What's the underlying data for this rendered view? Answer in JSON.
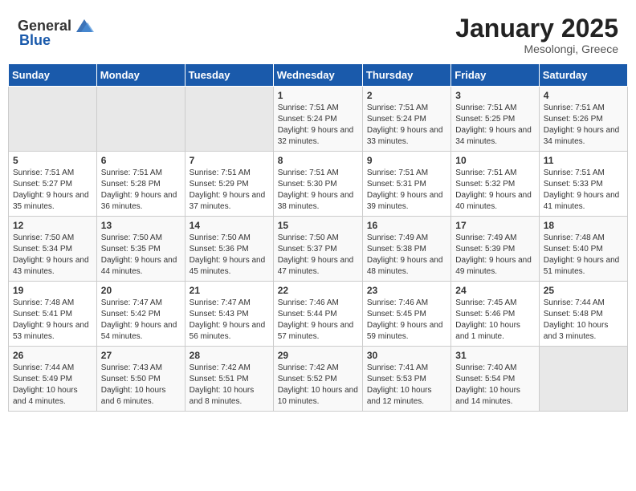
{
  "header": {
    "logo_general": "General",
    "logo_blue": "Blue",
    "month_title": "January 2025",
    "location": "Mesolongi, Greece"
  },
  "weekdays": [
    "Sunday",
    "Monday",
    "Tuesday",
    "Wednesday",
    "Thursday",
    "Friday",
    "Saturday"
  ],
  "weeks": [
    [
      {
        "day": "",
        "empty": true
      },
      {
        "day": "",
        "empty": true
      },
      {
        "day": "",
        "empty": true
      },
      {
        "day": "1",
        "sunrise": "7:51 AM",
        "sunset": "5:24 PM",
        "daylight": "9 hours and 32 minutes."
      },
      {
        "day": "2",
        "sunrise": "7:51 AM",
        "sunset": "5:24 PM",
        "daylight": "9 hours and 33 minutes."
      },
      {
        "day": "3",
        "sunrise": "7:51 AM",
        "sunset": "5:25 PM",
        "daylight": "9 hours and 34 minutes."
      },
      {
        "day": "4",
        "sunrise": "7:51 AM",
        "sunset": "5:26 PM",
        "daylight": "9 hours and 34 minutes."
      }
    ],
    [
      {
        "day": "5",
        "sunrise": "7:51 AM",
        "sunset": "5:27 PM",
        "daylight": "9 hours and 35 minutes."
      },
      {
        "day": "6",
        "sunrise": "7:51 AM",
        "sunset": "5:28 PM",
        "daylight": "9 hours and 36 minutes."
      },
      {
        "day": "7",
        "sunrise": "7:51 AM",
        "sunset": "5:29 PM",
        "daylight": "9 hours and 37 minutes."
      },
      {
        "day": "8",
        "sunrise": "7:51 AM",
        "sunset": "5:30 PM",
        "daylight": "9 hours and 38 minutes."
      },
      {
        "day": "9",
        "sunrise": "7:51 AM",
        "sunset": "5:31 PM",
        "daylight": "9 hours and 39 minutes."
      },
      {
        "day": "10",
        "sunrise": "7:51 AM",
        "sunset": "5:32 PM",
        "daylight": "9 hours and 40 minutes."
      },
      {
        "day": "11",
        "sunrise": "7:51 AM",
        "sunset": "5:33 PM",
        "daylight": "9 hours and 41 minutes."
      }
    ],
    [
      {
        "day": "12",
        "sunrise": "7:50 AM",
        "sunset": "5:34 PM",
        "daylight": "9 hours and 43 minutes."
      },
      {
        "day": "13",
        "sunrise": "7:50 AM",
        "sunset": "5:35 PM",
        "daylight": "9 hours and 44 minutes."
      },
      {
        "day": "14",
        "sunrise": "7:50 AM",
        "sunset": "5:36 PM",
        "daylight": "9 hours and 45 minutes."
      },
      {
        "day": "15",
        "sunrise": "7:50 AM",
        "sunset": "5:37 PM",
        "daylight": "9 hours and 47 minutes."
      },
      {
        "day": "16",
        "sunrise": "7:49 AM",
        "sunset": "5:38 PM",
        "daylight": "9 hours and 48 minutes."
      },
      {
        "day": "17",
        "sunrise": "7:49 AM",
        "sunset": "5:39 PM",
        "daylight": "9 hours and 49 minutes."
      },
      {
        "day": "18",
        "sunrise": "7:48 AM",
        "sunset": "5:40 PM",
        "daylight": "9 hours and 51 minutes."
      }
    ],
    [
      {
        "day": "19",
        "sunrise": "7:48 AM",
        "sunset": "5:41 PM",
        "daylight": "9 hours and 53 minutes."
      },
      {
        "day": "20",
        "sunrise": "7:47 AM",
        "sunset": "5:42 PM",
        "daylight": "9 hours and 54 minutes."
      },
      {
        "day": "21",
        "sunrise": "7:47 AM",
        "sunset": "5:43 PM",
        "daylight": "9 hours and 56 minutes."
      },
      {
        "day": "22",
        "sunrise": "7:46 AM",
        "sunset": "5:44 PM",
        "daylight": "9 hours and 57 minutes."
      },
      {
        "day": "23",
        "sunrise": "7:46 AM",
        "sunset": "5:45 PM",
        "daylight": "9 hours and 59 minutes."
      },
      {
        "day": "24",
        "sunrise": "7:45 AM",
        "sunset": "5:46 PM",
        "daylight": "10 hours and 1 minute."
      },
      {
        "day": "25",
        "sunrise": "7:44 AM",
        "sunset": "5:48 PM",
        "daylight": "10 hours and 3 minutes."
      }
    ],
    [
      {
        "day": "26",
        "sunrise": "7:44 AM",
        "sunset": "5:49 PM",
        "daylight": "10 hours and 4 minutes."
      },
      {
        "day": "27",
        "sunrise": "7:43 AM",
        "sunset": "5:50 PM",
        "daylight": "10 hours and 6 minutes."
      },
      {
        "day": "28",
        "sunrise": "7:42 AM",
        "sunset": "5:51 PM",
        "daylight": "10 hours and 8 minutes."
      },
      {
        "day": "29",
        "sunrise": "7:42 AM",
        "sunset": "5:52 PM",
        "daylight": "10 hours and 10 minutes."
      },
      {
        "day": "30",
        "sunrise": "7:41 AM",
        "sunset": "5:53 PM",
        "daylight": "10 hours and 12 minutes."
      },
      {
        "day": "31",
        "sunrise": "7:40 AM",
        "sunset": "5:54 PM",
        "daylight": "10 hours and 14 minutes."
      },
      {
        "day": "",
        "empty": true
      }
    ]
  ],
  "labels": {
    "sunrise": "Sunrise:",
    "sunset": "Sunset:",
    "daylight": "Daylight hours"
  }
}
